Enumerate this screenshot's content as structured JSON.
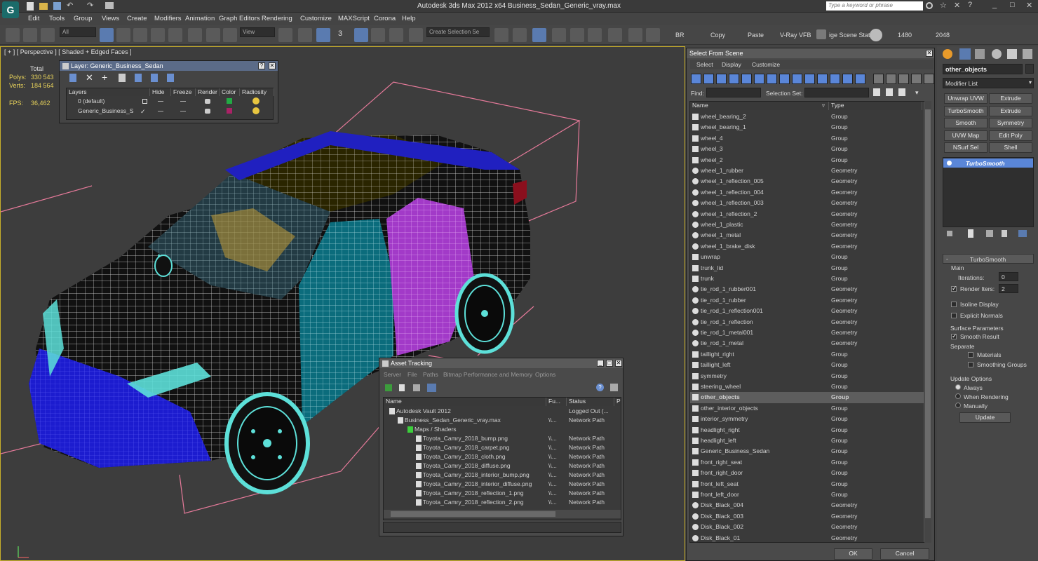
{
  "app": {
    "title": "Autodesk 3ds Max  2012 x64     Business_Sedan_Generic_vray.max",
    "search_placeholder": "Type a keyword or phrase"
  },
  "menu": [
    "Edit",
    "Tools",
    "Group",
    "Views",
    "Create",
    "Modifiers",
    "Animation",
    "Graph Editors",
    "Rendering",
    "Customize",
    "MAXScript",
    "Corona",
    "Help"
  ],
  "toolbar": {
    "filter": "All",
    "ref_coord": "View",
    "snap_value": "3",
    "named_sel_placeholder": "Create Selection Se",
    "labels": [
      "BR",
      "Copy",
      "Paste",
      "V-Ray VFB",
      "ige Scene Stat",
      "1480",
      "2048"
    ]
  },
  "viewport": {
    "label": "[ + ] [ Perspective ] [ Shaded + Edged Faces ]",
    "stats": {
      "total_label": "Total",
      "polys_label": "Polys:",
      "polys": "330 543",
      "verts_label": "Verts:",
      "verts": "184 564",
      "fps_label": "FPS:",
      "fps": "36,462"
    }
  },
  "layer_dialog": {
    "title": "Layer: Generic_Business_Sedan",
    "columns": [
      "Layers",
      "Hide",
      "Freeze",
      "Render",
      "Color",
      "Radiosity"
    ],
    "rows": [
      {
        "name": "0 (default)",
        "color": "#22aa44"
      },
      {
        "name": "Generic_Business_S",
        "color": "#aa2266"
      }
    ]
  },
  "asset_tracking": {
    "title": "Asset Tracking",
    "menu": [
      "Server",
      "File",
      "Paths",
      "Bitmap Performance and Memory",
      "Options"
    ],
    "columns": [
      "Name",
      "Fu...",
      "Status",
      "Pr"
    ],
    "rows": [
      {
        "name": "Autodesk Vault 2012",
        "full": "",
        "status": "Logged Out (..."
      },
      {
        "name": "Business_Sedan_Generic_vray.max",
        "full": "\\\\...",
        "status": "Network Path"
      },
      {
        "name": "Maps / Shaders",
        "full": "",
        "status": ""
      },
      {
        "name": "Toyota_Camry_2018_bump.png",
        "full": "\\\\...",
        "status": "Network Path"
      },
      {
        "name": "Toyota_Camry_2018_carpet.png",
        "full": "\\\\...",
        "status": "Network Path"
      },
      {
        "name": "Toyota_Camry_2018_cloth.png",
        "full": "\\\\...",
        "status": "Network Path"
      },
      {
        "name": "Toyota_Camry_2018_diffuse.png",
        "full": "\\\\...",
        "status": "Network Path"
      },
      {
        "name": "Toyota_Camry_2018_interior_bump.png",
        "full": "\\\\...",
        "status": "Network Path"
      },
      {
        "name": "Toyota_Camry_2018_interior_diffuse.png",
        "full": "\\\\...",
        "status": "Network Path"
      },
      {
        "name": "Toyota_Camry_2018_reflection_1.png",
        "full": "\\\\...",
        "status": "Network Path"
      },
      {
        "name": "Toyota_Camry_2018_reflection_2.png",
        "full": "\\\\...",
        "status": "Network Path"
      }
    ]
  },
  "select_from_scene": {
    "title": "Select From Scene",
    "tabs": [
      "Select",
      "Display",
      "Customize"
    ],
    "find_label": "Find:",
    "selection_set_label": "Selection Set:",
    "columns": [
      "Name",
      "Type"
    ],
    "rows": [
      [
        "wheel_bearing_2",
        "Group"
      ],
      [
        "wheel_bearing_1",
        "Group"
      ],
      [
        "wheel_4",
        "Group"
      ],
      [
        "wheel_3",
        "Group"
      ],
      [
        "wheel_2",
        "Group"
      ],
      [
        "wheel_1_rubber",
        "Geometry"
      ],
      [
        "wheel_1_reflection_005",
        "Geometry"
      ],
      [
        "wheel_1_reflection_004",
        "Geometry"
      ],
      [
        "wheel_1_reflection_003",
        "Geometry"
      ],
      [
        "wheel_1_reflection_2",
        "Geometry"
      ],
      [
        "wheel_1_plastic",
        "Geometry"
      ],
      [
        "wheel_1_metal",
        "Geometry"
      ],
      [
        "wheel_1_brake_disk",
        "Geometry"
      ],
      [
        "unwrap",
        "Group"
      ],
      [
        "trunk_lid",
        "Group"
      ],
      [
        "trunk",
        "Group"
      ],
      [
        "tie_rod_1_rubber001",
        "Geometry"
      ],
      [
        "tie_rod_1_rubber",
        "Geometry"
      ],
      [
        "tie_rod_1_reflection001",
        "Geometry"
      ],
      [
        "tie_rod_1_reflection",
        "Geometry"
      ],
      [
        "tie_rod_1_metal001",
        "Geometry"
      ],
      [
        "tie_rod_1_metal",
        "Geometry"
      ],
      [
        "taillight_right",
        "Group"
      ],
      [
        "taillight_left",
        "Group"
      ],
      [
        "symmetry",
        "Group"
      ],
      [
        "steering_wheel",
        "Group"
      ],
      [
        "other_objects",
        "Group"
      ],
      [
        "other_interior_objects",
        "Group"
      ],
      [
        "interior_symmetry",
        "Group"
      ],
      [
        "headlight_right",
        "Group"
      ],
      [
        "headlight_left",
        "Group"
      ],
      [
        "Generic_Business_Sedan",
        "Group"
      ],
      [
        "front_right_seat",
        "Group"
      ],
      [
        "front_right_door",
        "Group"
      ],
      [
        "front_left_seat",
        "Group"
      ],
      [
        "front_left_door",
        "Group"
      ],
      [
        "Disk_Black_004",
        "Geometry"
      ],
      [
        "Disk_Black_003",
        "Geometry"
      ],
      [
        "Disk_Black_002",
        "Geometry"
      ],
      [
        "Disk_Black_01",
        "Geometry"
      ]
    ],
    "selected_row": "other_objects",
    "ok": "OK",
    "cancel": "Cancel"
  },
  "command_panel": {
    "object_name": "other_objects",
    "modifier_list": "Modifier List",
    "buttons": [
      "Unwrap UVW",
      "Extrude",
      "TurboSmooth",
      "Extrude",
      "Smooth",
      "Symmetry",
      "UVW Map",
      "Edit Poly",
      "NSurf Sel",
      "Shell"
    ],
    "stack_item": "TurboSmooth",
    "rollout": "TurboSmooth",
    "main_label": "Main",
    "iterations_label": "Iterations:",
    "iterations": "0",
    "render_iters_label": "Render Iters:",
    "render_iters": "2",
    "isoline": "Isoline Display",
    "explicit_normals": "Explicit Normals",
    "surface_params": "Surface Parameters",
    "smooth_result": "Smooth Result",
    "separate": "Separate",
    "materials": "Materials",
    "smoothing_groups": "Smoothing Groups",
    "update_options": "Update Options",
    "always": "Always",
    "when_rendering": "When Rendering",
    "manually": "Manually",
    "update": "Update"
  }
}
